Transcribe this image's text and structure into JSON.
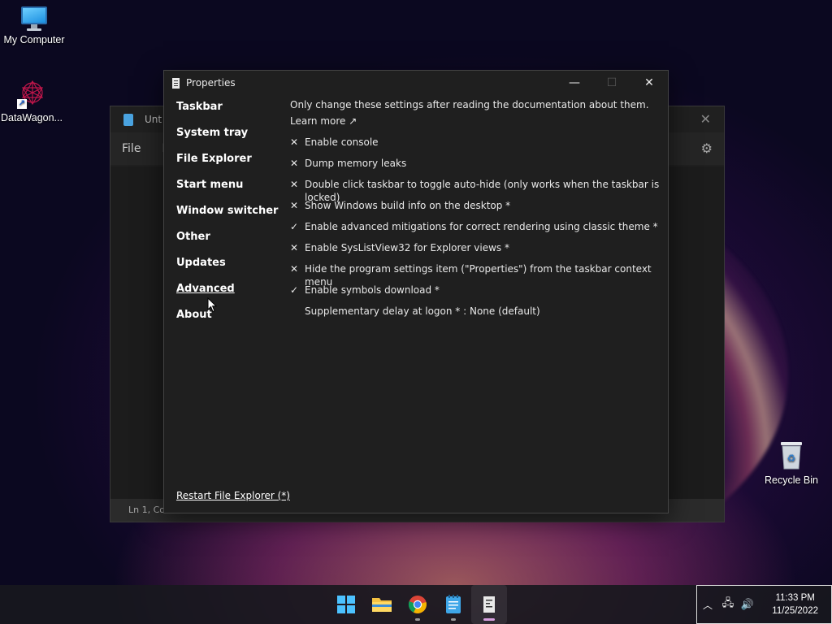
{
  "desktop": {
    "icons": [
      {
        "label": "My Computer"
      },
      {
        "label": "DataWagon..."
      },
      {
        "label": "Recycle Bin"
      }
    ]
  },
  "notepad": {
    "title": "Unt",
    "menu": [
      "File",
      "E"
    ],
    "status": "Ln 1, Col"
  },
  "properties": {
    "title": "Properties",
    "nav": [
      "Taskbar",
      "System tray",
      "File Explorer",
      "Start menu",
      "Window switcher",
      "Other",
      "Updates",
      "Advanced",
      "About"
    ],
    "active_nav": "Advanced",
    "note": "Only change these settings after reading the documentation about them.",
    "learn_more": "Learn more ↗",
    "options": [
      {
        "mark": "✕",
        "label": "Enable console"
      },
      {
        "mark": "✕",
        "label": "Dump memory leaks"
      },
      {
        "mark": "✕",
        "label": "Double click taskbar to toggle auto-hide (only works when the taskbar is locked)"
      },
      {
        "mark": "✕",
        "label": "Show Windows build info on the desktop *"
      },
      {
        "mark": "✓",
        "label": "Enable advanced mitigations for correct rendering using classic theme *"
      },
      {
        "mark": "✕",
        "label": "Enable SysListView32 for Explorer views *"
      },
      {
        "mark": "✕",
        "label": "Hide the program settings item (\"Properties\") from the taskbar context menu"
      },
      {
        "mark": "✓",
        "label": "Enable symbols download *"
      }
    ],
    "delay_setting": "Supplementary delay at logon * : None (default)",
    "restart_link": "Restart File Explorer (*)"
  },
  "taskbar": {
    "apps": [
      "start-icon",
      "file-explorer-icon",
      "chrome-icon",
      "notepad-icon",
      "properties-icon"
    ],
    "time": "11:33 PM",
    "date": "11/25/2022"
  },
  "colors": {
    "window_bg": "#1f1f1f",
    "accent_indicator": "#d8a0e0"
  }
}
